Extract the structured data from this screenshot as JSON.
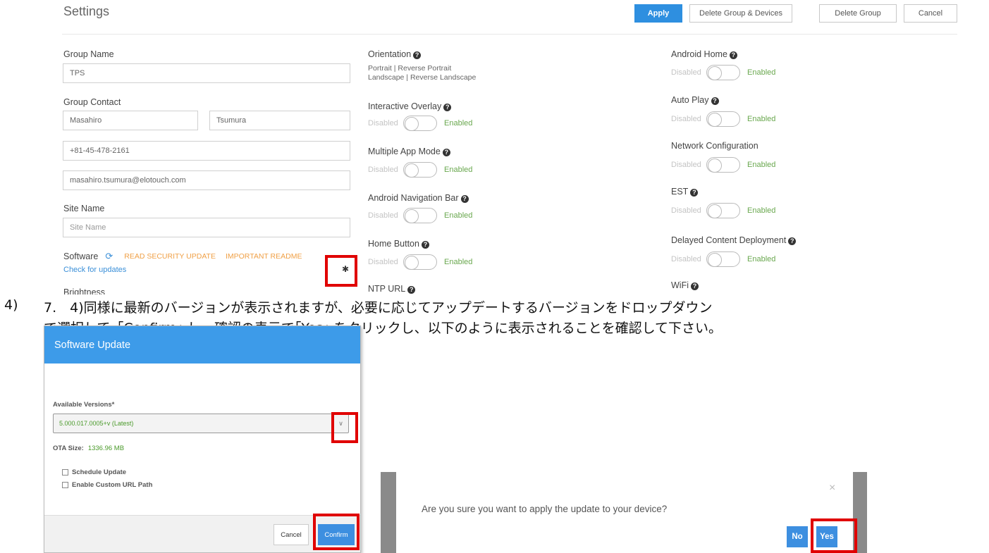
{
  "settings": {
    "title": "Settings",
    "buttons": {
      "apply": "Apply",
      "delete_group_devices": "Delete Group & Devices",
      "delete_group": "Delete Group",
      "cancel": "Cancel"
    },
    "group_name": {
      "label": "Group Name",
      "value": "TPS"
    },
    "group_contact": {
      "label": "Group Contact",
      "first_name": "Masahiro",
      "last_name": "Tsumura",
      "phone": "+81-45-478-2161",
      "email": "masahiro.tsumura@elotouch.com"
    },
    "site_name": {
      "label": "Site Name",
      "placeholder": "Site Name"
    },
    "software": {
      "label": "Software",
      "read_security_update": "READ SECURITY UPDATE",
      "important_readme": "IMPORTANT README",
      "check_for_updates": "Check for updates"
    },
    "brightness": {
      "label": "Brightness"
    },
    "orientation": {
      "label": "Orientation",
      "line1": "Portrait |  Reverse Portrait",
      "line2": "Landscape |  Reverse Landscape"
    },
    "toggle_disabled": "Disabled",
    "toggle_enabled": "Enabled",
    "middle_toggles": [
      "Interactive Overlay",
      "Multiple App Mode",
      "Android Navigation Bar",
      "Home Button"
    ],
    "ntp_url": "NTP URL",
    "right_toggles": [
      "Android Home",
      "Auto Play",
      "Network Configuration",
      "EST",
      "Delayed Content Deployment"
    ],
    "wifi": "WiFi"
  },
  "instruction": {
    "number": "4)",
    "line1": "7.　4)同様に最新のバージョンが表示されますが、必要に応じてアップデートするバージョンをドロップダウン",
    "line2": "で選択して､｢Confirm｣ し、確認の表示で｢Yes｣ をクリックし、以下のように表示されることを確認して下さい。"
  },
  "software_update_dialog": {
    "title": "Software Update",
    "available_versions_label": "Available Versions*",
    "selected_version": "5.000.017.0005+v (Latest)",
    "ota_size_label": "OTA Size:",
    "ota_size_value": "1336.96 MB",
    "schedule_update": "Schedule Update",
    "enable_custom_url_path": "Enable Custom URL Path",
    "cancel": "Cancel",
    "confirm": "Confirm"
  },
  "confirm_dialog": {
    "message": "Are you sure you want to apply the update to your device?",
    "no": "No",
    "yes": "Yes",
    "close": "×"
  },
  "colors": {
    "primary_blue": "#2e8fe0",
    "dialog_header": "#3d9be9",
    "highlight_red": "#e00000",
    "enabled_green": "#6aa84f",
    "link_orange": "#f0a046"
  }
}
